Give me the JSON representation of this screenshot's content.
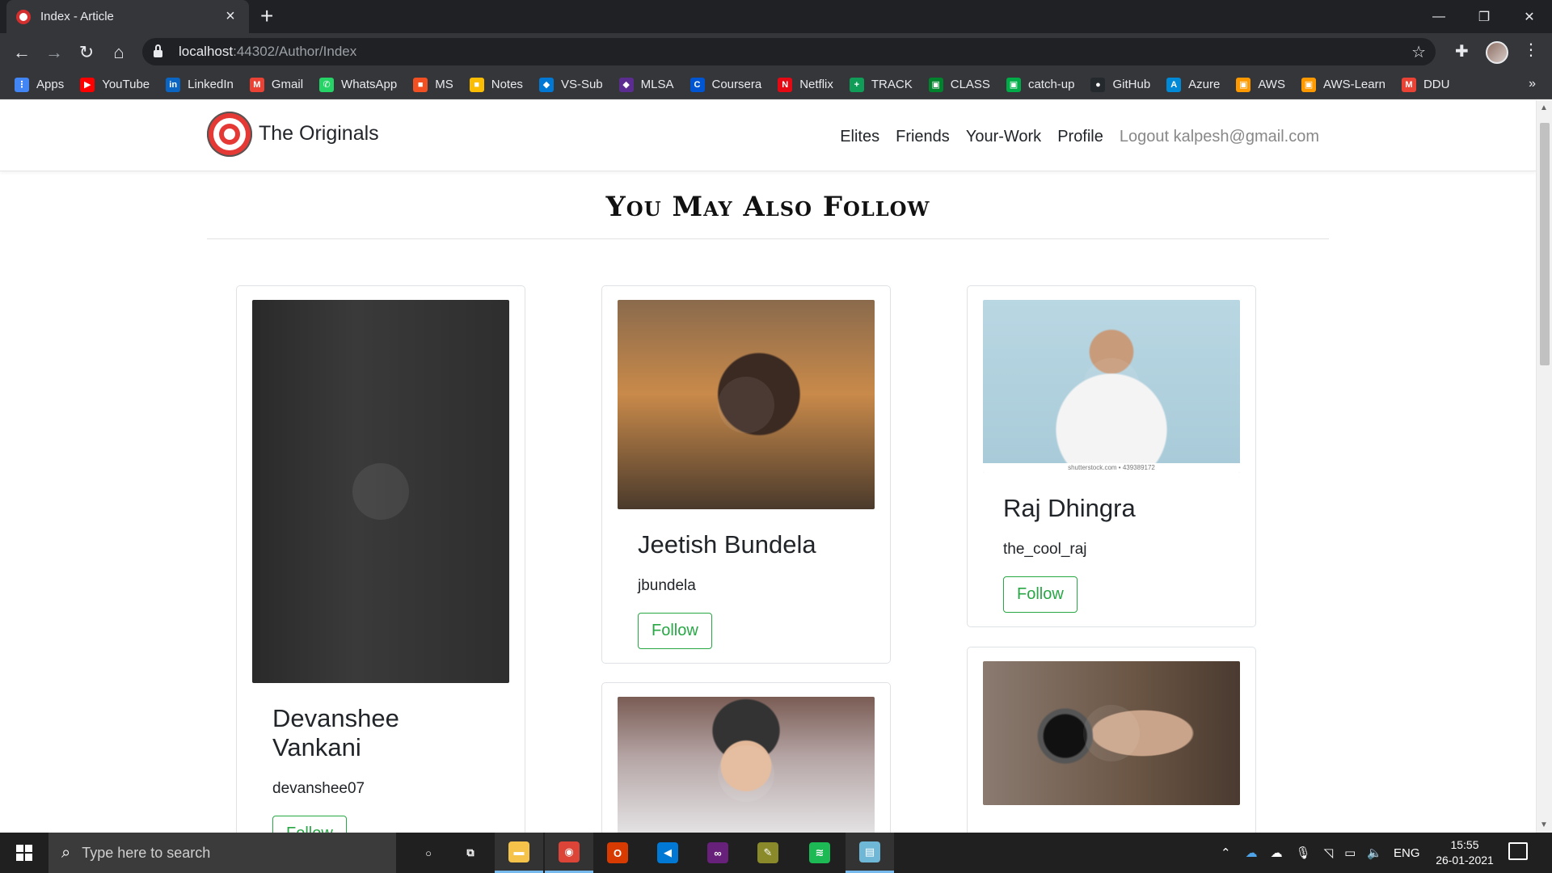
{
  "browser": {
    "tab_title": "Index - Article",
    "tab_close": "×",
    "new_tab": "+",
    "url_host": "localhost",
    "url_rest": ":44302/Author/Index",
    "window_controls": {
      "minimize": "—",
      "restore": "❐",
      "close": "✕"
    },
    "nav": {
      "back": "←",
      "forward": "→",
      "reload": "↻",
      "home": "⌂"
    },
    "bookmarks": [
      {
        "label": "Apps",
        "color": "#4285f4",
        "glyph": "⋮"
      },
      {
        "label": "YouTube",
        "color": "#ff0000",
        "glyph": "▶"
      },
      {
        "label": "LinkedIn",
        "color": "#0a66c2",
        "glyph": "in"
      },
      {
        "label": "Gmail",
        "color": "#ea4335",
        "glyph": "M"
      },
      {
        "label": "WhatsApp",
        "color": "#25d366",
        "glyph": "✆"
      },
      {
        "label": "MS",
        "color": "#f25022",
        "glyph": "■"
      },
      {
        "label": "Notes",
        "color": "#fbbc04",
        "glyph": "■"
      },
      {
        "label": "VS-Sub",
        "color": "#0078d4",
        "glyph": "◆"
      },
      {
        "label": "MLSA",
        "color": "#5c2d91",
        "glyph": "◆"
      },
      {
        "label": "Coursera",
        "color": "#0056d2",
        "glyph": "C"
      },
      {
        "label": "Netflix",
        "color": "#e50914",
        "glyph": "N"
      },
      {
        "label": "TRACK",
        "color": "#0f9d58",
        "glyph": "+"
      },
      {
        "label": "CLASS",
        "color": "#00832d",
        "glyph": "▣"
      },
      {
        "label": "catch-up",
        "color": "#00ac47",
        "glyph": "▣"
      },
      {
        "label": "GitHub",
        "color": "#24292e",
        "glyph": "●"
      },
      {
        "label": "Azure",
        "color": "#0089d6",
        "glyph": "A"
      },
      {
        "label": "AWS",
        "color": "#ff9900",
        "glyph": "▣"
      },
      {
        "label": "AWS-Learn",
        "color": "#ff9900",
        "glyph": "▣"
      },
      {
        "label": "DDU",
        "color": "#ea4335",
        "glyph": "M"
      }
    ],
    "bookmarks_more": "»"
  },
  "site": {
    "brand": "The Originals",
    "nav_links": [
      "Elites",
      "Friends",
      "Your-Work",
      "Profile"
    ],
    "logout": "Logout kalpesh@gmail.com"
  },
  "section_title": "You May Also Follow",
  "authors": [
    {
      "name": "Devanshee Vankani",
      "username": "devanshee07",
      "follow": "Follow"
    },
    {
      "name": "Jeetish Bundela",
      "username": "jbundela",
      "follow": "Follow"
    },
    {
      "name": "Raj Dhingra",
      "username": "the_cool_raj",
      "follow": "Follow",
      "image_caption": "shutterstock.com • 439389172"
    }
  ],
  "taskbar": {
    "search_placeholder": "Type here to search",
    "language": "ENG",
    "time": "15:55",
    "date": "26-01-2021",
    "apps": [
      {
        "name": "cortana",
        "glyph": "○",
        "color": "#202020"
      },
      {
        "name": "task-view",
        "glyph": "⧉",
        "color": "#202020"
      },
      {
        "name": "file-explorer",
        "glyph": "▬",
        "color": "#f6c34a"
      },
      {
        "name": "chrome",
        "glyph": "◉",
        "color": "#db4437"
      },
      {
        "name": "office",
        "glyph": "O",
        "color": "#d83b01"
      },
      {
        "name": "vscode",
        "glyph": "◀",
        "color": "#0078d4"
      },
      {
        "name": "visual-studio",
        "glyph": "∞",
        "color": "#68217a"
      },
      {
        "name": "tool",
        "glyph": "✎",
        "color": "#8a8a2a"
      },
      {
        "name": "spotify",
        "glyph": "≋",
        "color": "#1db954"
      },
      {
        "name": "notepad",
        "glyph": "▤",
        "color": "#6fb7d6"
      }
    ]
  }
}
